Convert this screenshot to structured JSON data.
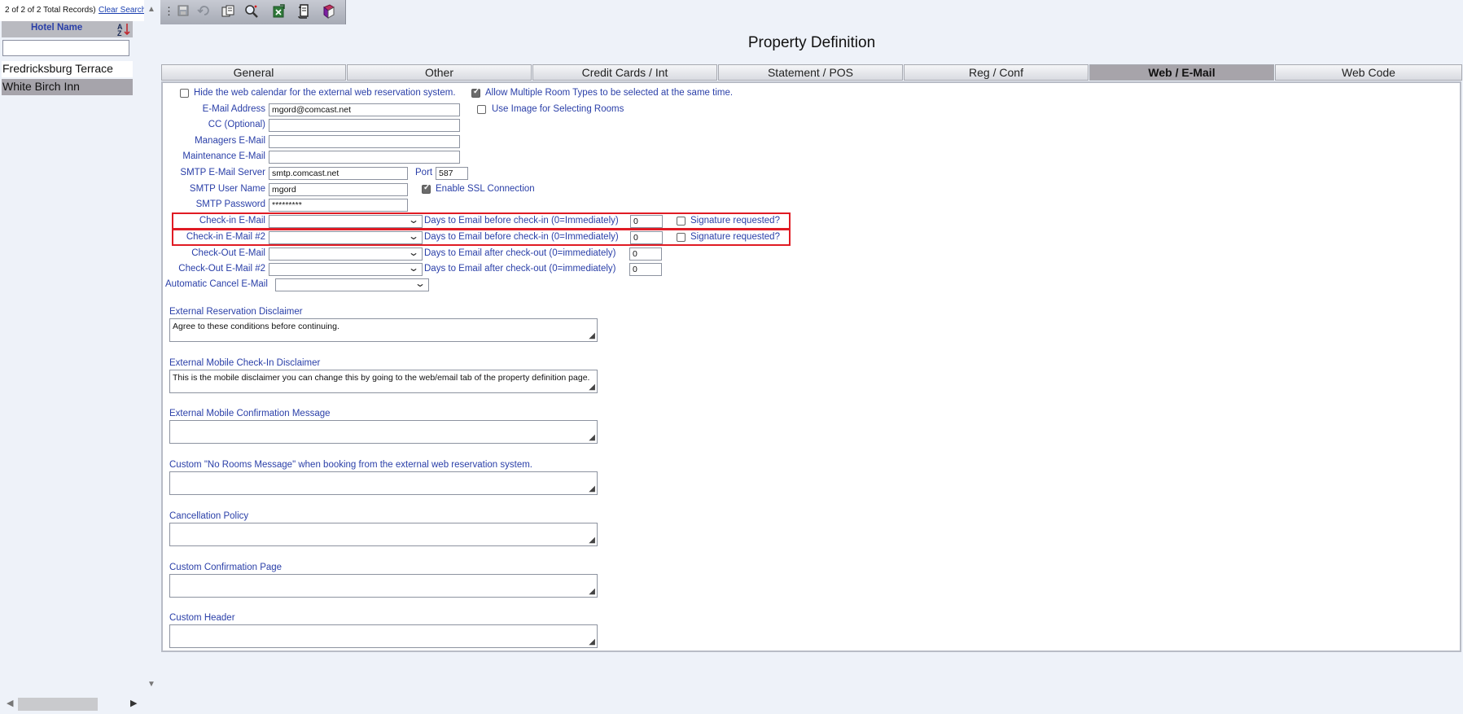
{
  "left_panel": {
    "record_count": "2 of 2 of 2 Total Records)",
    "clear_search": "Clear Search",
    "column_header": "Hotel Name",
    "search_value": "",
    "hotels": [
      "Fredricksburg Terrace",
      "White Birch Inn"
    ],
    "selected_index": 1
  },
  "toolbar": {
    "buttons": [
      "save-icon",
      "undo-icon",
      "copy-icon",
      "search-icon",
      "export-icon",
      "report-icon",
      "help-book-icon"
    ]
  },
  "page": {
    "title": "Property Definition"
  },
  "tabs": [
    {
      "label": "General",
      "active": false
    },
    {
      "label": "Other",
      "active": false
    },
    {
      "label": "Credit Cards / Int",
      "active": false
    },
    {
      "label": "Statement / POS",
      "active": false
    },
    {
      "label": "Reg / Conf",
      "active": false
    },
    {
      "label": "Web / E-Mail",
      "active": true
    },
    {
      "label": "Web Code",
      "active": false
    }
  ],
  "form": {
    "hide_web_calendar": {
      "label": "Hide the web calendar for the external web reservation system.",
      "checked": false
    },
    "allow_multiple_room_types": {
      "label": "Allow Multiple Room Types to be selected at the same time.",
      "checked": true
    },
    "use_image_rooms": {
      "label": "Use Image for Selecting Rooms",
      "checked": false
    },
    "email_address": {
      "label": "E-Mail Address",
      "value": "mgord@comcast.net"
    },
    "cc": {
      "label": "CC (Optional)",
      "value": ""
    },
    "managers_email": {
      "label": "Managers E-Mail",
      "value": ""
    },
    "maintenance_email": {
      "label": "Maintenance E-Mail",
      "value": ""
    },
    "smtp_server": {
      "label": "SMTP E-Mail Server",
      "value": "smtp.comcast.net"
    },
    "port": {
      "label": "Port",
      "value": "587"
    },
    "smtp_user": {
      "label": "SMTP User Name",
      "value": "mgord"
    },
    "enable_ssl": {
      "label": "Enable SSL Connection",
      "checked": true
    },
    "smtp_password": {
      "label": "SMTP Password",
      "value": "*********"
    },
    "checkin_email": {
      "label": "Check-in E-Mail",
      "value": "",
      "days_label": "Days to Email before check-in (0=Immediately)",
      "days": "0",
      "signature_label": "Signature requested?",
      "signature": false
    },
    "checkin_email2": {
      "label": "Check-in E-Mail #2",
      "value": "",
      "days_label": "Days to Email before check-in (0=Immediately)",
      "days": "0",
      "signature_label": "Signature requested?",
      "signature": false
    },
    "checkout_email": {
      "label": "Check-Out E-Mail",
      "value": "",
      "days_label": "Days to Email after check-out (0=immediately)",
      "days": "0"
    },
    "checkout_email2": {
      "label": "Check-Out E-Mail #2",
      "value": "",
      "days_label": "Days to Email after check-out (0=immediately)",
      "days": "0"
    },
    "auto_cancel_email": {
      "label": "Automatic Cancel E-Mail",
      "value": ""
    },
    "ext_res_disclaimer": {
      "label": "External Reservation Disclaimer",
      "value": "Agree to these conditions before continuing."
    },
    "ext_mobile_checkin_disclaimer": {
      "label": "External Mobile Check-In Disclaimer",
      "value": "This is the mobile disclaimer you can change this by going to the web/email tab of the property definition page."
    },
    "ext_mobile_confirmation": {
      "label": "External Mobile Confirmation Message",
      "value": ""
    },
    "no_rooms_message": {
      "label": "Custom \"No Rooms Message\" when booking from the external web reservation system.",
      "value": ""
    },
    "cancellation_policy": {
      "label": "Cancellation Policy",
      "value": ""
    },
    "custom_confirmation_page": {
      "label": "Custom Confirmation Page",
      "value": ""
    },
    "custom_header": {
      "label": "Custom Header",
      "value": ""
    }
  }
}
